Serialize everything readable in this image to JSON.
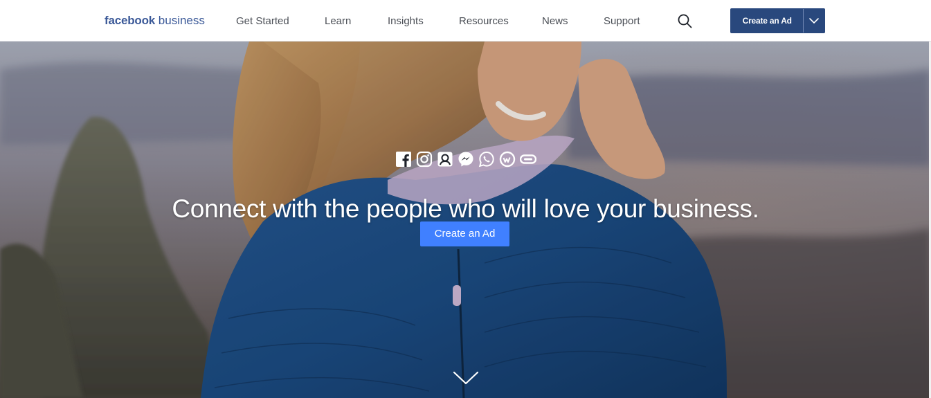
{
  "header": {
    "brand_bold": "facebook",
    "brand_light": "business",
    "nav": [
      {
        "label": "Get Started"
      },
      {
        "label": "Learn"
      },
      {
        "label": "Insights"
      },
      {
        "label": "Resources"
      },
      {
        "label": "News"
      },
      {
        "label": "Support"
      }
    ],
    "search_icon": "search-icon",
    "cta_label": "Create an Ad",
    "cta_dropdown_icon": "chevron-down-icon"
  },
  "hero": {
    "app_icons": [
      "facebook-icon",
      "instagram-icon",
      "audience-network-icon",
      "messenger-icon",
      "whatsapp-icon",
      "workplace-icon",
      "oculus-icon"
    ],
    "headline": "Connect with the people who will love your business.",
    "cta_label": "Create an Ad",
    "scroll_icon": "chevron-down-icon"
  },
  "colors": {
    "brand": "#3b5998",
    "header_cta": "#29487d",
    "hero_cta": "#4080ff",
    "nav_text": "#4b4f56"
  }
}
